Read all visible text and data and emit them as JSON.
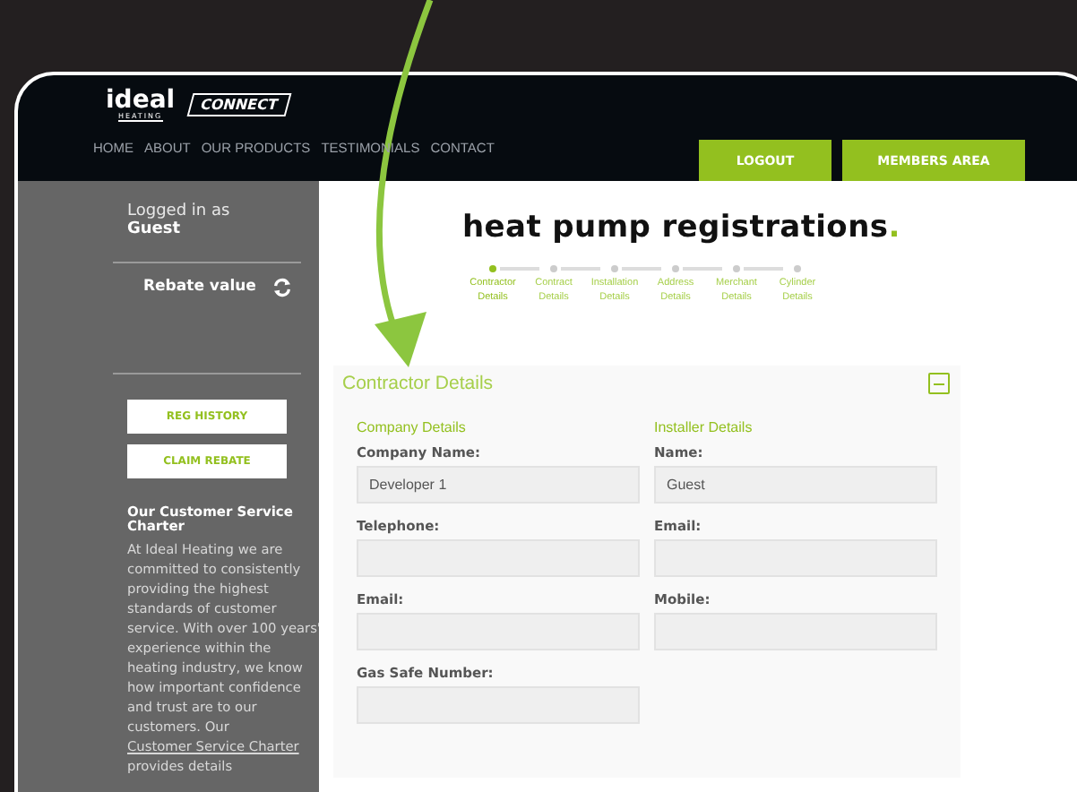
{
  "logo": {
    "brand": "ideal",
    "sub": "HEATING",
    "product": "CONNECT"
  },
  "nav": [
    {
      "label": "HOME"
    },
    {
      "label": "ABOUT"
    },
    {
      "label": "OUR PRODUCTS"
    },
    {
      "label": "TESTIMONIALS"
    },
    {
      "label": "CONTACT"
    }
  ],
  "header_buttons": [
    "LOGOUT",
    "MEMBERS AREA"
  ],
  "sidebar": {
    "logged_in_label": "Logged in as",
    "user": "Guest",
    "rebate_label": "Rebate value",
    "buttons": [
      "REG HISTORY",
      "CLAIM REBATE"
    ],
    "charter_title": "Our Customer Service Charter",
    "charter_text": "At Ideal Heating we are committed to consistently providing the highest standards of customer service. With over 100 years' experience within the heating industry, we know how important confidence and trust are to our customers. Our",
    "charter_link": "Customer Service Charter",
    "charter_after": "provides details"
  },
  "page_title": "heat pump registrations",
  "title_dot": ".",
  "steps": [
    {
      "label": "Contractor Details",
      "selected": true
    },
    {
      "label": "Contract Details",
      "selected": false
    },
    {
      "label": "Installation Details",
      "selected": false
    },
    {
      "label": "Address Details",
      "selected": false
    },
    {
      "label": "Merchant Details",
      "selected": false
    },
    {
      "label": "Cylinder Details",
      "selected": false
    }
  ],
  "panel": {
    "title": "Contractor Details",
    "expanded": true,
    "columns": [
      {
        "heading": "Company Details",
        "fields": [
          {
            "label": "Company Name:",
            "value": "Developer 1"
          },
          {
            "label": "Telephone:"
          },
          {
            "label": "Email:"
          },
          {
            "label": "Gas Safe Number:"
          }
        ]
      },
      {
        "heading": "Installer Details",
        "fields": [
          {
            "label": "Name:",
            "value": "Guest"
          },
          {
            "label": "Email:"
          },
          {
            "label": "Mobile:"
          }
        ]
      }
    ]
  }
}
